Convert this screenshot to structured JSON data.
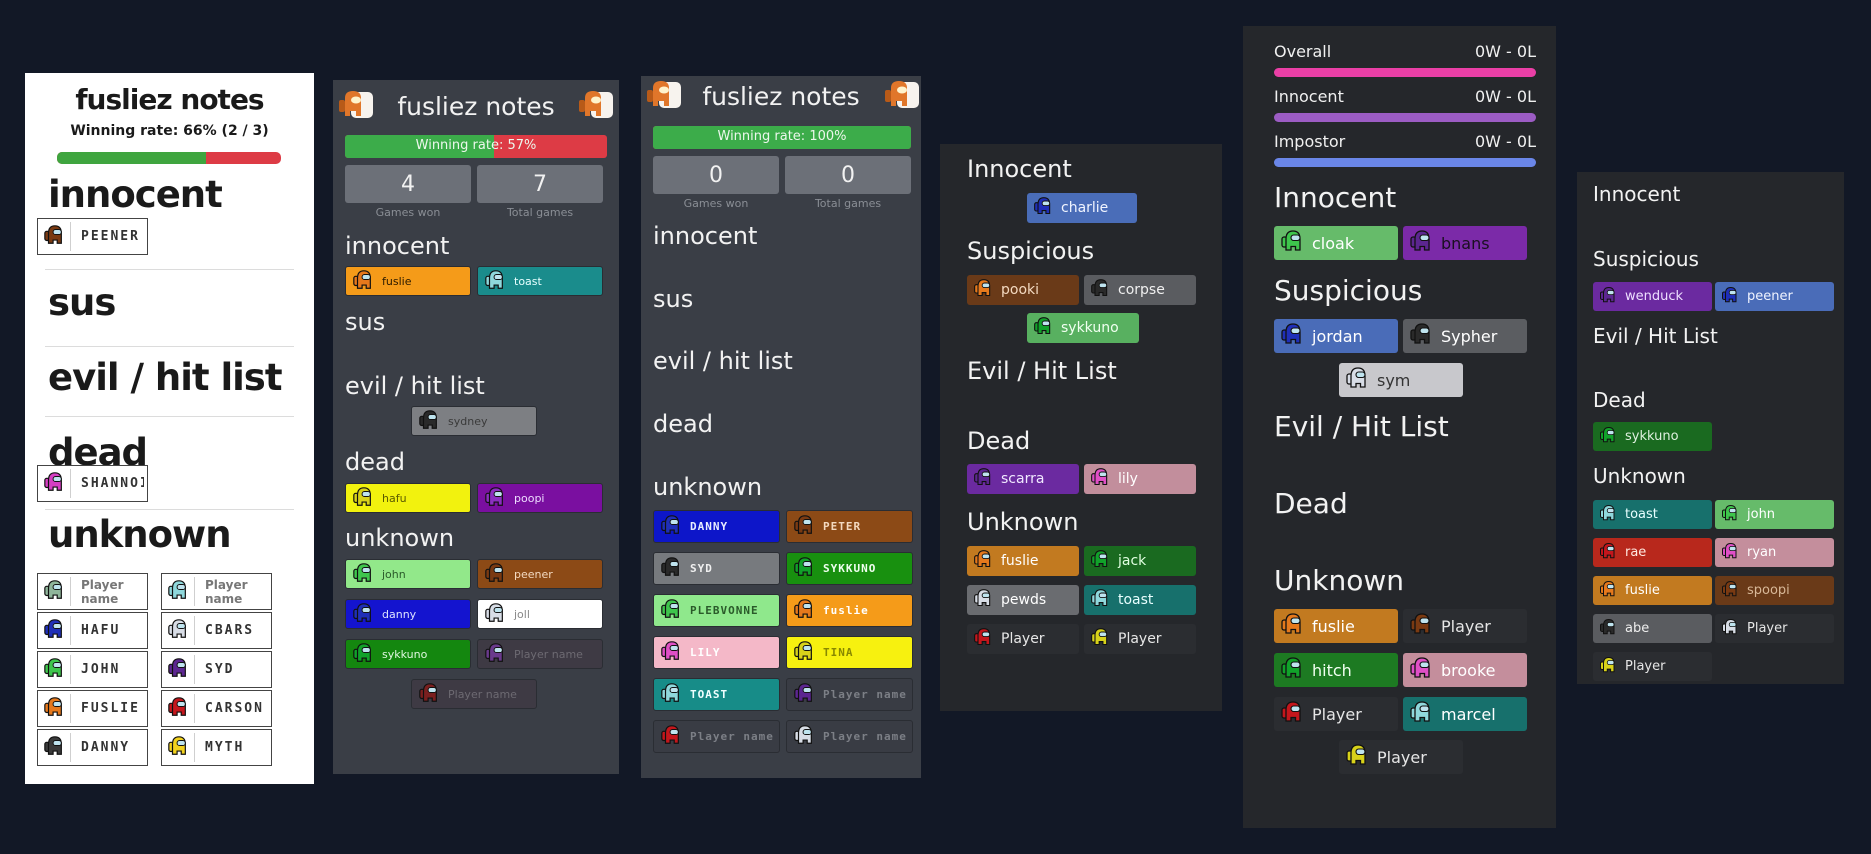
{
  "p1": {
    "title": "fusliez notes",
    "rate": "Winning rate: 66% (2 / 3)",
    "rate_fraction": 0.667,
    "headings": {
      "innocent": "innocent",
      "sus": "sus",
      "evil": "evil / hit list",
      "dead": "dead",
      "unknown": "unknown"
    },
    "innocent_player": {
      "name": "PEENER",
      "color": "#7a3a12"
    },
    "dead_player": {
      "name": "SHANNOI",
      "color": "#d63fc3"
    },
    "unknown_players": [
      {
        "name": "Player name",
        "color": "#8fb59a",
        "placeholder": true
      },
      {
        "name": "Player name",
        "color": "#8fd8dc",
        "placeholder": true
      },
      {
        "name": "HAFU",
        "color": "#1f2fb8"
      },
      {
        "name": "CBARS",
        "color": "#d8dde6"
      },
      {
        "name": "JOHN",
        "color": "#3ec64c"
      },
      {
        "name": "SYD",
        "color": "#5c2690"
      },
      {
        "name": "FUSLIE",
        "color": "#e6791c"
      },
      {
        "name": "CARSON",
        "color": "#c4161c"
      },
      {
        "name": "DANNY",
        "color": "#3a3a3a"
      },
      {
        "name": "MYTH",
        "color": "#f2d21e"
      }
    ]
  },
  "p2": {
    "title": "fusliez notes",
    "rate": "Winning rate: 57%",
    "rate_fraction": 0.57,
    "won": "4",
    "won_label": "Games won",
    "total": "7",
    "total_label": "Total games",
    "headings": {
      "innocent": "innocent",
      "sus": "sus",
      "evil": "evil / hit list",
      "dead": "dead",
      "unknown": "unknown"
    },
    "innocent": [
      {
        "name": "fuslie",
        "bg": "#f59b19",
        "crew": "#e6791c",
        "fg": "#2a1a00"
      },
      {
        "name": "toast",
        "bg": "#1a8c8c",
        "crew": "#8fd8dc",
        "fg": "#e8ffff"
      }
    ],
    "evil": [
      {
        "name": "sydney",
        "bg": "#7d7f83",
        "crew": "#2a2a2a",
        "fg": "#3a3a3a"
      }
    ],
    "dead": [
      {
        "name": "hafu",
        "bg": "#f2f20e",
        "crew": "#d8d21a",
        "fg": "#5a5a00"
      },
      {
        "name": "poopi",
        "bg": "#7a0fa0",
        "crew": "#8c2fc0",
        "fg": "#eeddff"
      }
    ],
    "unknown": [
      {
        "name": "john",
        "bg": "#92e88a",
        "crew": "#3ec64c",
        "fg": "#2a5a2a"
      },
      {
        "name": "peener",
        "bg": "#8c4a16",
        "crew": "#7a3a12",
        "fg": "#f3d9c0"
      },
      {
        "name": "danny",
        "bg": "#1414cf",
        "crew": "#1f2fb8",
        "fg": "#dde3ff"
      },
      {
        "name": "joll",
        "bg": "#ffffff",
        "crew": "#d8dde6",
        "fg": "#888888"
      },
      {
        "name": "sykkuno",
        "bg": "#14870f",
        "crew": "#11a22a",
        "fg": "#dff7df"
      },
      {
        "name": "Player name",
        "bg": "#3e3a44",
        "crew": "#6a3a8c",
        "fg": "#6d6a72"
      },
      {
        "name": "Player name",
        "bg": "#3e3a44",
        "crew": "#7a1f1f",
        "fg": "#6d6a72"
      }
    ]
  },
  "p3": {
    "title": "fusliez notes",
    "rate": "Winning rate: 100%",
    "rate_fraction": 1.0,
    "won": "0",
    "won_label": "Games won",
    "total": "0",
    "total_label": "Total games",
    "headings": {
      "innocent": "innocent",
      "sus": "sus",
      "evil": "evil / hit list",
      "dead": "dead",
      "unknown": "unknown"
    },
    "unknown": [
      {
        "name": "DANNY",
        "bg": "#0d16c9",
        "crew": "#1f2fb8",
        "fg": "#e8ecff"
      },
      {
        "name": "PETER",
        "bg": "#8c4a16",
        "crew": "#7a3a12",
        "fg": "#f3d9c0"
      },
      {
        "name": "SYD",
        "bg": "#777a7e",
        "crew": "#2a2a2a",
        "fg": "#f0f0f0"
      },
      {
        "name": "SYKKUNO",
        "bg": "#18900f",
        "crew": "#11a22a",
        "fg": "#f0fff0"
      },
      {
        "name": "PLEBVONNE",
        "bg": "#8fe88c",
        "crew": "#3ec64c",
        "fg": "#2a5a2a"
      },
      {
        "name": "fuslie",
        "bg": "#f59b19",
        "crew": "#e6791c",
        "fg": "#ffffff"
      },
      {
        "name": "LILY",
        "bg": "#f4b8c8",
        "crew": "#e04fc6",
        "fg": "#ffffff"
      },
      {
        "name": "TINA",
        "bg": "#f7f10f",
        "crew": "#d8d21a",
        "fg": "#888800"
      },
      {
        "name": "TOAST",
        "bg": "#178c88",
        "crew": "#8fd8dc",
        "fg": "#f0ffff"
      },
      {
        "name": "Player name",
        "bg": "#393c44",
        "crew": "#5c2690",
        "fg": "#7c7f86"
      },
      {
        "name": "Player name",
        "bg": "#393c44",
        "crew": "#c4161c",
        "fg": "#7c7f86"
      },
      {
        "name": "Player name",
        "bg": "#393c44",
        "crew": "#d8dde6",
        "fg": "#7c7f86"
      }
    ]
  },
  "p4": {
    "headings": {
      "innocent": "Innocent",
      "sus": "Suspicious",
      "evil": "Evil / Hit List",
      "dead": "Dead",
      "unknown": "Unknown"
    },
    "innocent": [
      {
        "name": "charlie",
        "bg": "#4a6db8",
        "crew": "#1f2fb8",
        "fg": "#f0f4ff"
      }
    ],
    "sus": [
      {
        "name": "pooki",
        "bg": "#6a3a18",
        "crew": "#e6791c",
        "fg": "#f3d9c0"
      },
      {
        "name": "corpse",
        "bg": "#5a5c60",
        "crew": "#2a2a2a",
        "fg": "#f0f0f0"
      },
      {
        "name": "sykkuno",
        "bg": "#58b060",
        "crew": "#11a22a",
        "fg": "#f0fff0"
      }
    ],
    "dead": [
      {
        "name": "scarra",
        "bg": "#6b2aa0",
        "crew": "#5c2690",
        "fg": "#f0e8ff"
      },
      {
        "name": "lily",
        "bg": "#c28e9c",
        "crew": "#e04fc6",
        "fg": "#ffffff"
      }
    ],
    "unknown": [
      {
        "name": "fuslie",
        "bg": "#c27a20",
        "crew": "#e6791c",
        "fg": "#ffffff"
      },
      {
        "name": "jack",
        "bg": "#1a6a20",
        "crew": "#11a22a",
        "fg": "#e0ffe0"
      },
      {
        "name": "pewds",
        "bg": "#6a6c70",
        "crew": "#d8dde6",
        "fg": "#ffffff"
      },
      {
        "name": "toast",
        "bg": "#17706c",
        "crew": "#8fd8dc",
        "fg": "#e8ffff"
      },
      {
        "name": "Player",
        "bg": "#2b2d31",
        "crew": "#c4161c",
        "fg": "#e6e6e6"
      },
      {
        "name": "Player",
        "bg": "#2b2d31",
        "crew": "#d8d21a",
        "fg": "#e6e6e6"
      }
    ]
  },
  "p5": {
    "overall": {
      "label": "Overall",
      "value": "0W - 0L",
      "color": "#ea3fa6"
    },
    "innocent_stat": {
      "label": "Innocent",
      "value": "0W - 0L",
      "color": "#9c5cc4"
    },
    "impostor_stat": {
      "label": "Impostor",
      "value": "0W - 0L",
      "color": "#6a86e8"
    },
    "headings": {
      "innocent": "Innocent",
      "sus": "Suspicious",
      "evil": "Evil / Hit List",
      "dead": "Dead",
      "unknown": "Unknown"
    },
    "innocent": [
      {
        "name": "cloak",
        "bg": "#66bb6a",
        "crew": "#3ec64c",
        "fg": "#ffffff"
      },
      {
        "name": "bnans",
        "bg": "#7b2aa8",
        "crew": "#5c2690",
        "fg": "#1a0f20"
      }
    ],
    "sus": [
      {
        "name": "jordan",
        "bg": "#4a6cb8",
        "crew": "#1f2fb8",
        "fg": "#ffffff"
      },
      {
        "name": "Sypher",
        "bg": "#5b5d61",
        "crew": "#2a2a2a",
        "fg": "#ffffff"
      },
      {
        "name": "sym",
        "bg": "#c8c8cc",
        "crew": "#d8dde6",
        "fg": "#333333"
      }
    ],
    "unknown": [
      {
        "name": "fuslie",
        "bg": "#c27a20",
        "crew": "#e6791c",
        "fg": "#ffffff"
      },
      {
        "name": "Player",
        "bg": "#2b2d31",
        "crew": "#7a3a12",
        "fg": "#e6e6e6"
      },
      {
        "name": "hitch",
        "bg": "#1d7a22",
        "crew": "#11a22a",
        "fg": "#f0fff0"
      },
      {
        "name": "brooke",
        "bg": "#c48e9c",
        "crew": "#e04fc6",
        "fg": "#ffffff"
      },
      {
        "name": "Player",
        "bg": "#2b2d31",
        "crew": "#c4161c",
        "fg": "#e6e6e6"
      },
      {
        "name": "marcel",
        "bg": "#17706c",
        "crew": "#8fd8dc",
        "fg": "#ffffff"
      },
      {
        "name": "Player",
        "bg": "#2b2d31",
        "crew": "#d8d21a",
        "fg": "#e6e6e6"
      }
    ]
  },
  "p6": {
    "headings": {
      "innocent": "Innocent",
      "sus": "Suspicious",
      "evil": "Evil / Hit List",
      "dead": "Dead",
      "unknown": "Unknown"
    },
    "sus": [
      {
        "name": "wenduck",
        "bg": "#6b2aa0",
        "crew": "#5c2690",
        "fg": "#eedfff"
      },
      {
        "name": "peener",
        "bg": "#4a6cb8",
        "crew": "#1f2fb8",
        "fg": "#f0f4ff"
      }
    ],
    "dead": [
      {
        "name": "sykkuno",
        "bg": "#1a6a20",
        "crew": "#11a22a",
        "fg": "#dff0df"
      }
    ],
    "unknown": [
      {
        "name": "toast",
        "bg": "#17706c",
        "crew": "#8fd8dc",
        "fg": "#e8ffff"
      },
      {
        "name": "john",
        "bg": "#66bb6a",
        "crew": "#3ec64c",
        "fg": "#ffffff"
      },
      {
        "name": "rae",
        "bg": "#b8281c",
        "crew": "#c4161c",
        "fg": "#ffe8e0"
      },
      {
        "name": "ryan",
        "bg": "#c48e9c",
        "crew": "#e04fc6",
        "fg": "#ffffff"
      },
      {
        "name": "fuslie",
        "bg": "#c27a20",
        "crew": "#e6791c",
        "fg": "#ffffff"
      },
      {
        "name": "spoopi",
        "bg": "#6a3a18",
        "crew": "#7a3a12",
        "fg": "#d8b898"
      },
      {
        "name": "abe",
        "bg": "#5a5c60",
        "crew": "#2a2a2a",
        "fg": "#eeeeee"
      },
      {
        "name": "Player",
        "bg": "#2b2d31",
        "crew": "#d8dde6",
        "fg": "#e6e6e6"
      },
      {
        "name": "Player",
        "bg": "#2b2d31",
        "crew": "#d8d21a",
        "fg": "#e6e6e6"
      }
    ]
  }
}
